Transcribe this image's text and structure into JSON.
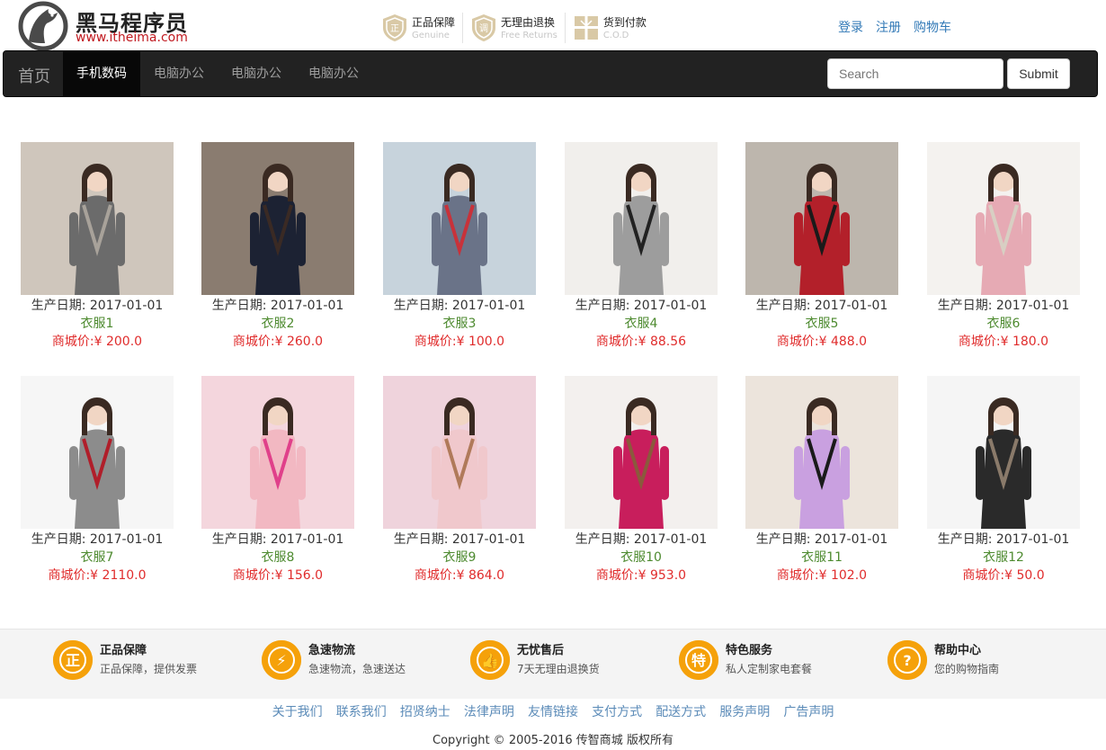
{
  "header": {
    "logo_title": "黑马程序员",
    "logo_url": "www.itheima.com",
    "promises": [
      {
        "icon": "genuine-shield-icon",
        "cn": "正品保障",
        "en": "Genuine"
      },
      {
        "icon": "return-shield-icon",
        "cn": "无理由退换",
        "en": "Free Returns"
      },
      {
        "icon": "gift-box-icon",
        "cn": "货到付款",
        "en": "C.O.D"
      }
    ],
    "links": [
      "登录",
      "注册",
      "购物车"
    ]
  },
  "navbar": {
    "brand": "首页",
    "items": [
      "手机数码",
      "电脑办公",
      "电脑办公",
      "电脑办公"
    ],
    "active_index": 0,
    "search_placeholder": "Search",
    "submit_label": "Submit"
  },
  "products": [
    {
      "date_label": "生产日期:",
      "date": "2017-01-01",
      "name": "衣服1",
      "price_label": "商城价:",
      "price": "¥ 200.0",
      "image": {
        "bg": "#cfc6bc",
        "coat": "#6b6b6b",
        "accent": "#a8a29a"
      }
    },
    {
      "date_label": "生产日期:",
      "date": "2017-01-01",
      "name": "衣服2",
      "price_label": "商城价:",
      "price": "¥ 260.0",
      "image": {
        "bg": "#8a7c70",
        "coat": "#1c2233",
        "accent": "#3a2a24"
      }
    },
    {
      "date_label": "生产日期:",
      "date": "2017-01-01",
      "name": "衣服3",
      "price_label": "商城价:",
      "price": "¥ 100.0",
      "image": {
        "bg": "#c7d3dc",
        "coat": "#6a7388",
        "accent": "#c8323a"
      }
    },
    {
      "date_label": "生产日期:",
      "date": "2017-01-01",
      "name": "衣服4",
      "price_label": "商城价:",
      "price": "¥ 88.56",
      "image": {
        "bg": "#f1efec",
        "coat": "#9d9d9d",
        "accent": "#222222"
      }
    },
    {
      "date_label": "生产日期:",
      "date": "2017-01-01",
      "name": "衣服5",
      "price_label": "商城价:",
      "price": "¥ 488.0",
      "image": {
        "bg": "#bdb6ad",
        "coat": "#b3202a",
        "accent": "#1a1a1a"
      }
    },
    {
      "date_label": "生产日期:",
      "date": "2017-01-01",
      "name": "衣服6",
      "price_label": "商城价:",
      "price": "¥ 180.0",
      "image": {
        "bg": "#f4f2ef",
        "coat": "#e6aab4",
        "accent": "#d8cfc3"
      }
    },
    {
      "date_label": "生产日期:",
      "date": "2017-01-01",
      "name": "衣服7",
      "price_label": "商城价:",
      "price": "¥ 2110.0",
      "image": {
        "bg": "#f6f6f6",
        "coat": "#8c8c8c",
        "accent": "#b01e2a"
      }
    },
    {
      "date_label": "生产日期:",
      "date": "2017-01-01",
      "name": "衣服8",
      "price_label": "商城价:",
      "price": "¥ 156.0",
      "image": {
        "bg": "#f4d6dd",
        "coat": "#f2b8c2",
        "accent": "#e0408a"
      }
    },
    {
      "date_label": "生产日期:",
      "date": "2017-01-01",
      "name": "衣服9",
      "price_label": "商城价:",
      "price": "¥ 864.0",
      "image": {
        "bg": "#efd3dc",
        "coat": "#f0c8cc",
        "accent": "#b07a5a"
      }
    },
    {
      "date_label": "生产日期:",
      "date": "2017-01-01",
      "name": "衣服10",
      "price_label": "商城价:",
      "price": "¥ 953.0",
      "image": {
        "bg": "#f3f0ee",
        "coat": "#c81e5c",
        "accent": "#8a5a3c"
      }
    },
    {
      "date_label": "生产日期:",
      "date": "2017-01-01",
      "name": "衣服11",
      "price_label": "商城价:",
      "price": "¥ 102.0",
      "image": {
        "bg": "#ece4dc",
        "coat": "#c9a0e0",
        "accent": "#1a1a1a"
      }
    },
    {
      "date_label": "生产日期:",
      "date": "2017-01-01",
      "name": "衣服12",
      "price_label": "商城价:",
      "price": "¥ 50.0",
      "image": {
        "bg": "#f5f5f5",
        "coat": "#2a2a2a",
        "accent": "#8a7a6a"
      }
    }
  ],
  "services": [
    {
      "icon": "genuine-badge-icon",
      "glyph": "正",
      "title": "正品保障",
      "desc": "正品保障，提供发票"
    },
    {
      "icon": "express-delivery-icon",
      "glyph": "⚡",
      "title": "急速物流",
      "desc": "急速物流，急速送达"
    },
    {
      "icon": "thumbs-up-icon",
      "glyph": "👍",
      "title": "无忧售后",
      "desc": "7天无理由退换货"
    },
    {
      "icon": "special-service-icon",
      "glyph": "特",
      "title": "特色服务",
      "desc": "私人定制家电套餐"
    },
    {
      "icon": "help-question-icon",
      "glyph": "?",
      "title": "帮助中心",
      "desc": "您的购物指南"
    }
  ],
  "footer": {
    "links": [
      "关于我们",
      "联系我们",
      "招贤纳士",
      "法律声明",
      "友情链接",
      "支付方式",
      "配送方式",
      "服务声明",
      "广告声明"
    ],
    "copyright": "Copyright © 2005-2016 传智商城 版权所有"
  },
  "colors": {
    "navbar_bg": "#222222",
    "link": "#337ab7",
    "product_name": "#4d8a2f",
    "price": "#e02c2c",
    "service_icon": "#f5a10a"
  }
}
